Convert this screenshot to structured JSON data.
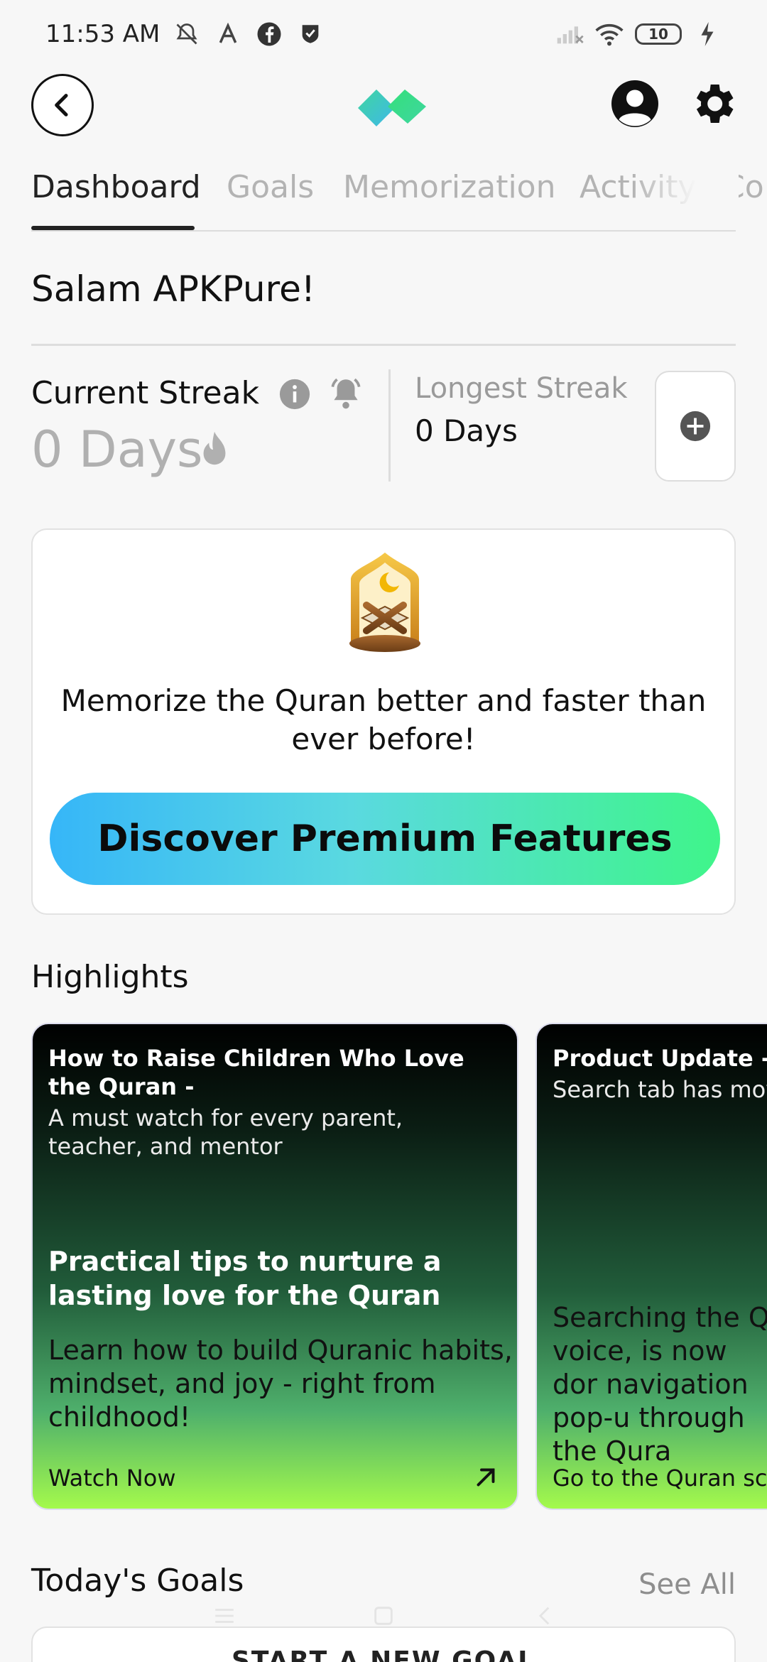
{
  "status_bar": {
    "time": "11:53 AM",
    "battery": "10",
    "icons": [
      "bell-off-icon",
      "text-a-icon",
      "facebook-icon",
      "shield-check-icon",
      "signal-icon",
      "wifi-icon",
      "battery-icon",
      "charging-icon"
    ]
  },
  "app_bar": {
    "icons": [
      "back-arrow-icon",
      "app-logo",
      "profile-icon",
      "gear-icon"
    ],
    "brand_colors": [
      "#3fd6a0",
      "#3fb8e8",
      "#34e07a"
    ]
  },
  "tabs": [
    {
      "label": "Dashboard",
      "active": true
    },
    {
      "label": "Goals",
      "active": false
    },
    {
      "label": "Memorization",
      "active": false
    },
    {
      "label": "Activity",
      "active": false
    },
    {
      "label": "Co",
      "active": false
    }
  ],
  "greeting": "Salam APKPure!",
  "streak": {
    "current_label": "Current Streak",
    "current_value": "0 Days",
    "longest_label": "Longest Streak",
    "longest_value": "0 Days"
  },
  "premium": {
    "message": "Memorize the Quran better and faster than ever before!",
    "button_label": "Discover Premium Features"
  },
  "highlights": {
    "title": "Highlights",
    "cards": [
      {
        "title": "How to Raise Children Who Love the Quran -",
        "subtitle": "A must watch for every parent, teacher, and mentor",
        "heading": "Practical tips to nurture a lasting love for the Quran",
        "body": "Learn how to build Quranic habits, mindset, and joy - right from childhood!",
        "cta": "Watch Now"
      },
      {
        "title": "Product Update -",
        "subtitle": "Search tab has mov",
        "body": "Searching the Q voice, is now dor navigation pop-u through the Qura",
        "cta": "Go to the Quran scr"
      }
    ]
  },
  "goals": {
    "title": "Today's Goals",
    "see_all": "See All",
    "card_label": "START A NEW GOAL"
  }
}
